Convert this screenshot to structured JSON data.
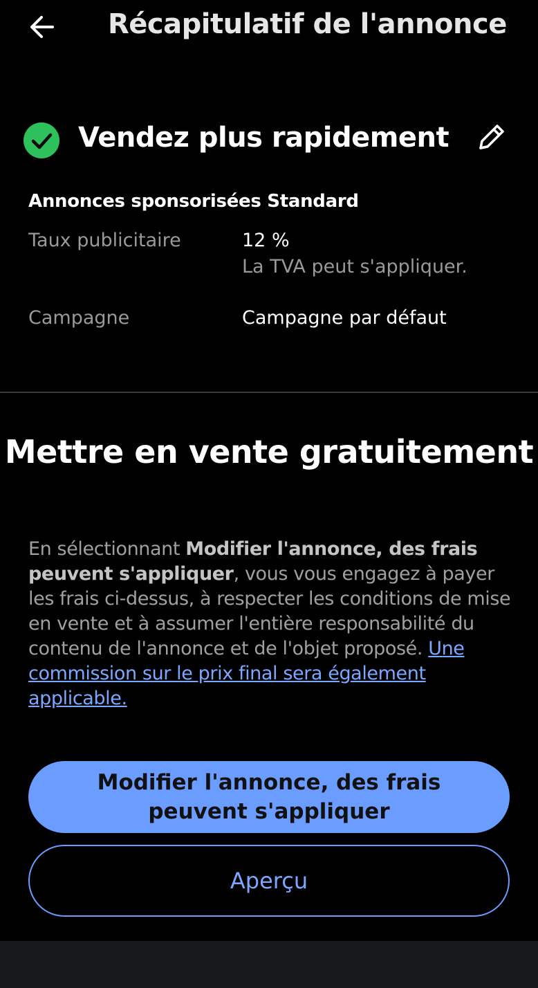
{
  "header": {
    "back_icon": "arrow-left-icon",
    "title": "Récapitulatif de l'annonce"
  },
  "promotion": {
    "status_icon": "check-circle-icon",
    "status_color": "#2ec05a",
    "title": "Vendez plus rapidement",
    "edit_icon": "pencil-icon",
    "plan_name": "Annonces sponsorisées Standard",
    "ad_rate_label": "Taux publicitaire",
    "ad_rate_value": "12 %",
    "ad_rate_note": "La TVA peut s'appliquer.",
    "campaign_label": "Campagne",
    "campaign_value": "Campagne par défaut"
  },
  "listing": {
    "title": "Mettre en vente gratuitement",
    "terms_prefix": "En sélectionnant ",
    "terms_bold": "Modifier l'annonce, des frais peuvent s'appliquer",
    "terms_body": ", vous vous engagez à payer les frais ci-dessus, à respecter les conditions de mise en vente et à assumer l'entière responsabilité du contenu de l'annonce et de l'objet proposé. ",
    "terms_link": "Une commission sur le prix final sera également applicable.",
    "primary_button": "Modifier l'annonce, des frais peuvent s'appliquer",
    "secondary_button": "Aperçu"
  },
  "colors": {
    "accent": "#6b9cff",
    "link": "#7aa7ff",
    "background": "#000000"
  }
}
